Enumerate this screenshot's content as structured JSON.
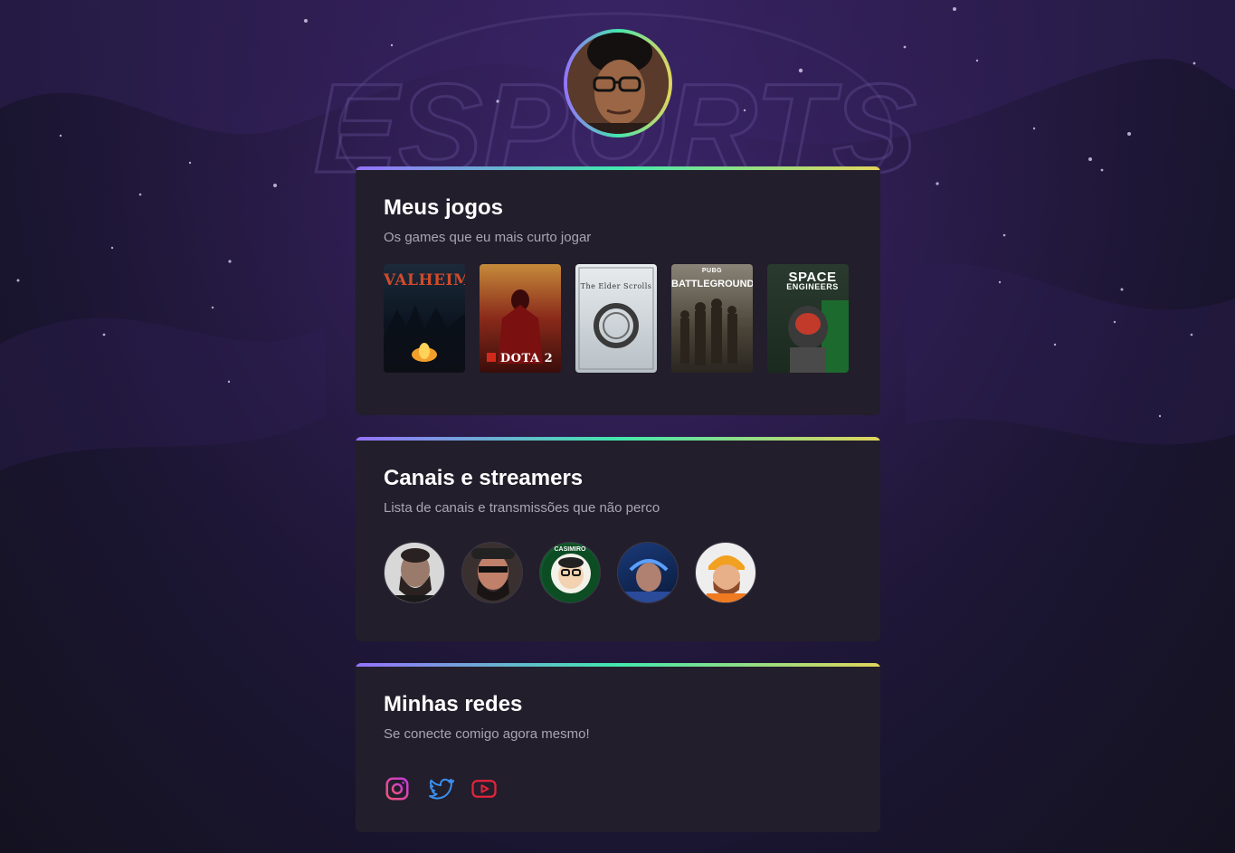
{
  "profile": {
    "avatar_alt": "Foto de perfil"
  },
  "background": {
    "watermark": "ESPORTS"
  },
  "colors": {
    "gradient_start": "#9572fc",
    "gradient_mid": "#43e7ad",
    "gradient_end": "#e2d45c",
    "card_bg": "#221e2b",
    "subtext": "#a9a6b3"
  },
  "sections": {
    "games": {
      "title": "Meus jogos",
      "subtitle": "Os games que eu mais curto jogar",
      "items": [
        {
          "name": "Valheim",
          "cover_text": "VALHEIM"
        },
        {
          "name": "Dota 2",
          "cover_text": "DOTA 2"
        },
        {
          "name": "The Elder Scrolls Online",
          "cover_text": "The Elder Scrolls"
        },
        {
          "name": "PUBG Battlegrounds",
          "cover_text": "BATTLEGROUNDS",
          "cover_badge": "PUBG"
        },
        {
          "name": "Space Engineers",
          "cover_text": "SPACE",
          "cover_text2": "ENGINEERS"
        }
      ]
    },
    "streamers": {
      "title": "Canais e streamers",
      "subtitle": "Lista de canais e transmissões que não perco",
      "items": [
        {
          "name": "streamer-1"
        },
        {
          "name": "streamer-2"
        },
        {
          "name": "casimiro",
          "badge_text": "CASIMIRO"
        },
        {
          "name": "streamer-4"
        },
        {
          "name": "streamer-5"
        }
      ]
    },
    "socials": {
      "title": "Minhas redes",
      "subtitle": "Se conecte comigo agora mesmo!",
      "items": [
        {
          "name": "instagram",
          "icon": "instagram-icon",
          "color": "#e53bb5"
        },
        {
          "name": "twitter",
          "icon": "twitter-icon",
          "color": "#3b8ff0"
        },
        {
          "name": "youtube",
          "icon": "youtube-icon",
          "color": "#e3243d"
        }
      ]
    }
  }
}
